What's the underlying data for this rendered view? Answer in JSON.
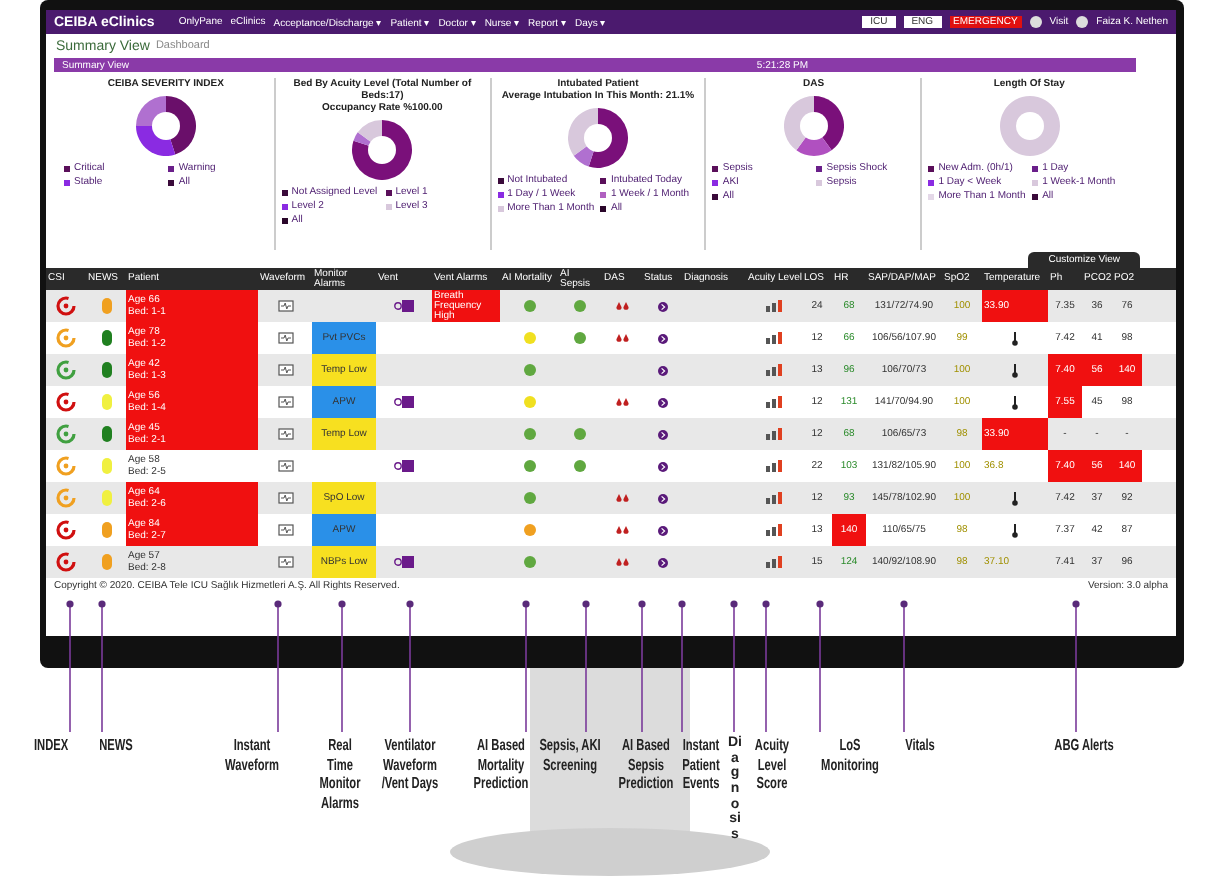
{
  "navbar": {
    "brand": "CEIBA eClinics",
    "menu": [
      "OnlyPane",
      "eClinics",
      "Acceptance/Discharge ▾",
      "Patient ▾",
      "Doctor ▾",
      "Nurse ▾",
      "Report ▾",
      "Days ▾"
    ],
    "unit": "ICU",
    "language": "ENG",
    "emergency": "EMERGENCY",
    "visit": "Visit",
    "user": "Faiza K. Nethen"
  },
  "page_title": {
    "main": "Summary View",
    "sub": "Dashboard"
  },
  "summary_bar": {
    "title": "Summary View",
    "time": "5:21:28 PM"
  },
  "cards": [
    {
      "title": [
        "CEIBA SEVERITY INDEX"
      ],
      "legend": [
        {
          "label": "Critical",
          "color": "#5a0f5a"
        },
        {
          "label": "Warning",
          "color": "#6a1f8a"
        },
        {
          "label": "Stable",
          "color": "#8a2be2"
        },
        {
          "label": "All",
          "color": "#3a0a3a"
        }
      ]
    },
    {
      "title": [
        "Bed By Acuity Level (Total Number of Beds:17)",
        "Occupancy Rate %100.00"
      ],
      "legend": [
        {
          "label": "Not Assigned Level",
          "color": "#3a0a3a"
        },
        {
          "label": "Level 1",
          "color": "#5a0f5a"
        },
        {
          "label": "Level 2",
          "color": "#8a2be2"
        },
        {
          "label": "Level 3",
          "color": "#d8c8dc"
        },
        {
          "label": "All",
          "color": "#2a062a"
        }
      ]
    },
    {
      "title": [
        "Intubated Patient",
        "Average Intubation In This Month: 21.1%"
      ],
      "legend": [
        {
          "label": "Not Intubated",
          "color": "#3a0a3a"
        },
        {
          "label": "Intubated Today",
          "color": "#5a0f5a"
        },
        {
          "label": "1 Day / 1 Week",
          "color": "#8a2be2"
        },
        {
          "label": "1 Week / 1 Month",
          "color": "#b060c0"
        },
        {
          "label": "More Than 1 Month",
          "color": "#d8c8dc"
        },
        {
          "label": "All",
          "color": "#2a062a"
        }
      ]
    },
    {
      "title": [
        "DAS"
      ],
      "legend": [
        {
          "label": "Sepsis",
          "color": "#5a0f5a"
        },
        {
          "label": "Sepsis Shock",
          "color": "#6a1f8a"
        },
        {
          "label": "AKI",
          "color": "#8a2be2"
        },
        {
          "label": "Sepsis",
          "color": "#d8c8dc"
        },
        {
          "label": "All",
          "color": "#3a0a3a"
        }
      ]
    },
    {
      "title": [
        "Length Of Stay"
      ],
      "legend": [
        {
          "label": "New Adm. (0h/1)",
          "color": "#5a0f5a"
        },
        {
          "label": "1 Day",
          "color": "#6a1f8a"
        },
        {
          "label": "1 Day < Week",
          "color": "#8a2be2"
        },
        {
          "label": "1 Week-1 Month",
          "color": "#d8c8dc"
        },
        {
          "label": "More Than 1 Month",
          "color": "#e4d8e8"
        },
        {
          "label": "All",
          "color": "#3a0a3a"
        }
      ]
    }
  ],
  "customize_tab": "Customize View",
  "table": {
    "columns": [
      "CSI",
      "NEWS",
      "Patient",
      "Waveform",
      "Monitor Alarms",
      "Vent",
      "Vent Alarms",
      "AI Mortality",
      "AI Sepsis",
      "DAS",
      "Status",
      "Diagnosis",
      "Acuity Level",
      "LOS",
      "HR",
      "SAP/DAP/MAP",
      "SpO2",
      "Temperature",
      "Ph",
      "PCO2",
      "PO2"
    ],
    "rows": [
      {
        "csi": {
          "color": "#d01010"
        },
        "news": {
          "color": "#f0a020"
        },
        "alert": true,
        "age": "Age 66",
        "bed": "Bed: 1-1",
        "alarm": null,
        "vent": true,
        "vent_alarm": "Breath Frequency High",
        "mortality": {
          "color": "#60a840"
        },
        "sepsis": {
          "color": "#60a840"
        },
        "das": true,
        "los": "24",
        "hr": "68",
        "hr_alert": false,
        "sap": "131/72/74.90",
        "spo2": "100",
        "temp": "33.90",
        "temp_alert": true,
        "abg": [
          {
            "value": "7.35",
            "alert": false
          },
          {
            "value": "36",
            "alert": false
          },
          {
            "value": "76",
            "alert": false
          }
        ]
      },
      {
        "csi": {
          "color": "#f0a020"
        },
        "news": {
          "color": "#208020"
        },
        "alert": true,
        "age": "Age 78",
        "bed": "Bed: 1-2",
        "alarm": {
          "text": "Pvt PVCs",
          "kind": "blue"
        },
        "vent": false,
        "vent_alarm": null,
        "mortality": {
          "color": "#f0e020"
        },
        "sepsis": {
          "color": "#60a840"
        },
        "das": true,
        "los": "12",
        "hr": "66",
        "hr_alert": false,
        "sap": "106/56/107.90",
        "spo2": "99",
        "abg": [
          {
            "value": "7.42",
            "alert": false
          },
          {
            "value": "41",
            "alert": false
          },
          {
            "value": "98",
            "alert": false
          }
        ]
      },
      {
        "csi": {
          "color": "#40a040"
        },
        "news": {
          "color": "#208020"
        },
        "alert": true,
        "age": "Age 42",
        "bed": "Bed: 1-3",
        "alarm": {
          "text": "Temp Low",
          "kind": "yellow"
        },
        "vent": false,
        "vent_alarm": null,
        "mortality": {
          "color": "#60a840"
        },
        "sepsis": null,
        "das": false,
        "los": "13",
        "hr": "96",
        "hr_alert": false,
        "sap": "106/70/73",
        "spo2": "100",
        "abg": [
          {
            "value": "7.40",
            "alert": true
          },
          {
            "value": "56",
            "alert": true
          },
          {
            "value": "140",
            "alert": true
          }
        ]
      },
      {
        "csi": {
          "color": "#d01010"
        },
        "news": {
          "color": "#f0f040"
        },
        "alert": true,
        "age": "Age 56",
        "bed": "Bed: 1-4",
        "alarm": {
          "text": "APW",
          "kind": "blue"
        },
        "vent": true,
        "vent_alarm": null,
        "mortality": {
          "color": "#f0e020"
        },
        "sepsis": null,
        "das": true,
        "los": "12",
        "hr": "131",
        "hr_alert": false,
        "sap": "141/70/94.90",
        "spo2": "100",
        "abg": [
          {
            "value": "7.55",
            "alert": true
          },
          {
            "value": "45",
            "alert": false
          },
          {
            "value": "98",
            "alert": false
          }
        ]
      },
      {
        "csi": {
          "color": "#40a040"
        },
        "news": {
          "color": "#208020"
        },
        "alert": true,
        "age": "Age 45",
        "bed": "Bed: 2-1",
        "alarm": {
          "text": "Temp Low",
          "kind": "yellow"
        },
        "vent": false,
        "vent_alarm": null,
        "mortality": {
          "color": "#60a840"
        },
        "sepsis": {
          "color": "#60a840"
        },
        "das": false,
        "los": "12",
        "hr": "68",
        "hr_alert": false,
        "sap": "106/65/73",
        "spo2": "98",
        "temp": "33.90",
        "temp_alert": true,
        "abg": [
          {
            "value": "-",
            "alert": false
          },
          {
            "value": "-",
            "alert": false
          },
          {
            "value": "-",
            "alert": false
          }
        ]
      },
      {
        "csi": {
          "color": "#f0a020"
        },
        "news": {
          "color": "#f0f040"
        },
        "alert": false,
        "age": "Age 58",
        "bed": "Bed: 2-5",
        "alarm": null,
        "vent": true,
        "vent_alarm": null,
        "mortality": {
          "color": "#60a840"
        },
        "sepsis": {
          "color": "#60a840"
        },
        "das": false,
        "los": "22",
        "hr": "103",
        "hr_alert": false,
        "sap": "131/82/105.90",
        "spo2": "100",
        "temp": "36.8",
        "temp_alert": false,
        "abg": [
          {
            "value": "7.40",
            "alert": true
          },
          {
            "value": "56",
            "alert": true
          },
          {
            "value": "140",
            "alert": true
          }
        ]
      },
      {
        "csi": {
          "color": "#f0a020"
        },
        "news": {
          "color": "#f0f040"
        },
        "alert": true,
        "age": "Age 64",
        "bed": "Bed: 2-6",
        "alarm": {
          "text": "SpO Low",
          "kind": "yellow"
        },
        "vent": false,
        "vent_alarm": null,
        "mortality": {
          "color": "#60a840"
        },
        "sepsis": null,
        "das": true,
        "los": "12",
        "hr": "93",
        "hr_alert": false,
        "sap": "145/78/102.90",
        "spo2": "100",
        "abg": [
          {
            "value": "7.42",
            "alert": false
          },
          {
            "value": "37",
            "alert": false
          },
          {
            "value": "92",
            "alert": false
          }
        ]
      },
      {
        "csi": {
          "color": "#d01010"
        },
        "news": {
          "color": "#f0a020"
        },
        "alert": true,
        "age": "Age 84",
        "bed": "Bed: 2-7",
        "alarm": {
          "text": "APW",
          "kind": "blue"
        },
        "vent": false,
        "vent_alarm": null,
        "mortality": {
          "color": "#f0a020"
        },
        "sepsis": null,
        "das": true,
        "los": "13",
        "hr": "140",
        "hr_alert": true,
        "sap": "110/65/75",
        "spo2": "98",
        "abg": [
          {
            "value": "7.37",
            "alert": false
          },
          {
            "value": "42",
            "alert": false
          },
          {
            "value": "87",
            "alert": false
          }
        ]
      },
      {
        "csi": {
          "color": "#d01010"
        },
        "news": {
          "color": "#f0a020"
        },
        "alert": false,
        "age": "Age 57",
        "bed": "Bed: 2-8",
        "alarm": {
          "text": "NBPs Low",
          "kind": "yellow"
        },
        "vent": true,
        "vent_alarm": null,
        "mortality": {
          "color": "#60a840"
        },
        "sepsis": null,
        "das": true,
        "los": "15",
        "hr": "124",
        "hr_alert": false,
        "sap": "140/92/108.90",
        "spo2": "98",
        "temp": "37.10",
        "temp_alert": false,
        "abg": [
          {
            "value": "7.41",
            "alert": false
          },
          {
            "value": "37",
            "alert": false
          },
          {
            "value": "96",
            "alert": false
          }
        ]
      }
    ]
  },
  "footer": {
    "copyright": "Copyright © 2020. CEIBA Tele ICU Sağlık Hizmetleri A.Ş. All Rights Reserved.",
    "version": "Version: 3.0 alpha"
  },
  "callouts": [
    {
      "label": "INDEX"
    },
    {
      "label": "NEWS"
    },
    {
      "label": "Instant Waveform"
    },
    {
      "label": "Real Time Monitor Alarms"
    },
    {
      "label": "Ventilator Waveform /Vent Days"
    },
    {
      "label": "AI Based Mortality Prediction"
    },
    {
      "label": "Sepsis, AKI Screening"
    },
    {
      "label": "AI Based Sepsis Prediction"
    },
    {
      "label": "Instant Patient Events"
    },
    {
      "label": "Diagnosis",
      "kind": "vertical"
    },
    {
      "label": "Acuity Level Score"
    },
    {
      "label": "LoS Monitoring"
    },
    {
      "label": "Vitals"
    },
    {
      "label": "ABG Alerts"
    }
  ]
}
